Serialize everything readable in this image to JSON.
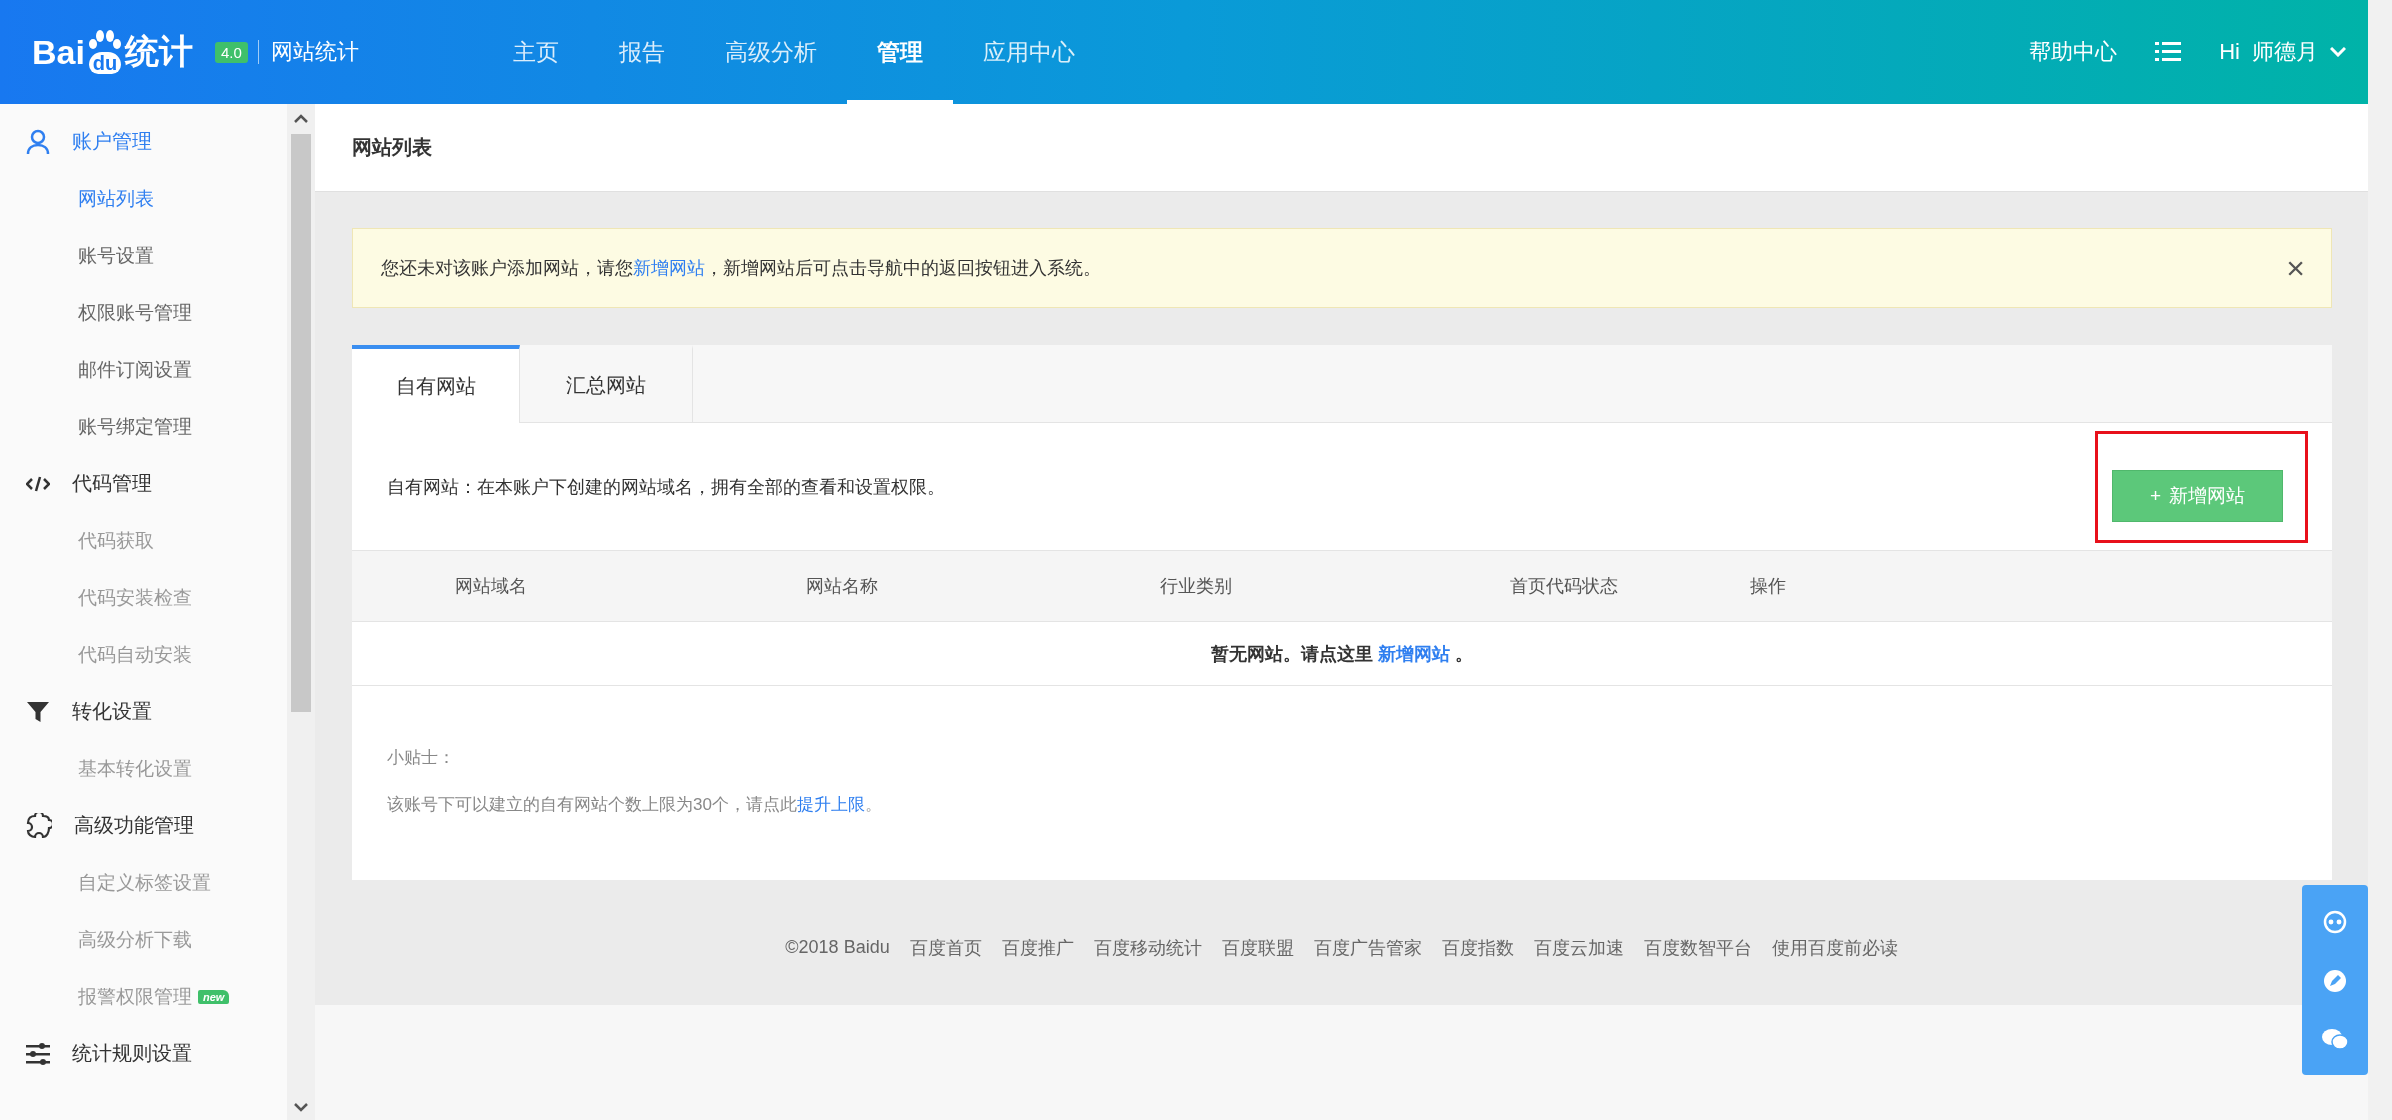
{
  "header": {
    "logo": {
      "text_before": "Bai",
      "paw_text": "du",
      "text_after": "统计"
    },
    "version": "4.0",
    "product": "网站统计",
    "nav": [
      {
        "label": "主页",
        "selected": false
      },
      {
        "label": "报告",
        "selected": false
      },
      {
        "label": "高级分析",
        "selected": false
      },
      {
        "label": "管理",
        "selected": true
      },
      {
        "label": "应用中心",
        "selected": false
      }
    ],
    "help": "帮助中心",
    "greeting": "Hi",
    "user": "师德月"
  },
  "sidebar": {
    "groups": [
      {
        "kind": "user",
        "label": "账户管理",
        "selected": true,
        "items": [
          {
            "label": "网站列表",
            "selected": true,
            "muted": false
          },
          {
            "label": "账号设置",
            "selected": false,
            "muted": false
          },
          {
            "label": "权限账号管理",
            "selected": false,
            "muted": false
          },
          {
            "label": "邮件订阅设置",
            "selected": false,
            "muted": false
          },
          {
            "label": "账号绑定管理",
            "selected": false,
            "muted": false
          }
        ]
      },
      {
        "kind": "code",
        "label": "代码管理",
        "selected": false,
        "items": [
          {
            "label": "代码获取",
            "selected": false,
            "muted": true
          },
          {
            "label": "代码安装检查",
            "selected": false,
            "muted": true
          },
          {
            "label": "代码自动安装",
            "selected": false,
            "muted": true
          }
        ]
      },
      {
        "kind": "filter",
        "label": "转化设置",
        "selected": false,
        "items": [
          {
            "label": "基本转化设置",
            "selected": false,
            "muted": true
          }
        ]
      },
      {
        "kind": "puzzle",
        "label": "高级功能管理",
        "selected": false,
        "items": [
          {
            "label": "自定义标签设置",
            "selected": false,
            "muted": true
          },
          {
            "label": "高级分析下载",
            "selected": false,
            "muted": true
          },
          {
            "label": "报警权限管理",
            "selected": false,
            "muted": true,
            "badge": "new"
          }
        ]
      },
      {
        "kind": "sliders",
        "label": "统计规则设置",
        "selected": false
      }
    ]
  },
  "page_title": "网站列表",
  "notice": {
    "text_before": "您还未对该账户添加网站，请您",
    "link": "新增网站",
    "text_after": "，新增网站后可点击导航中的返回按钮进入系统。",
    "close": "×"
  },
  "tabs": [
    {
      "label": "自有网站",
      "selected": true
    },
    {
      "label": "汇总网站",
      "selected": false
    }
  ],
  "description": "自有网站：在本账户下创建的网站域名，拥有全部的查看和设置权限。",
  "add_button": {
    "icon": "+",
    "label": "新增网站",
    "highlighted": true
  },
  "table": {
    "columns": [
      "网站域名",
      "网站名称",
      "行业类别",
      "首页代码状态",
      "操作"
    ],
    "empty": {
      "text_before": "暂无网站。请点这里",
      "link": "新增网站",
      "text_after": "。"
    }
  },
  "tips": {
    "title": "小贴士：",
    "text": "该账号下可以建立的自有网站个数上限为30个，请点此",
    "link": "提升上限",
    "end": "。"
  },
  "footer": {
    "copyright": "©2018 Baidu",
    "links": [
      "百度首页",
      "百度推广",
      "百度移动统计",
      "百度联盟",
      "百度广告管家",
      "百度指数",
      "百度云加速",
      "百度数智平台",
      "使用百度前必读"
    ]
  }
}
